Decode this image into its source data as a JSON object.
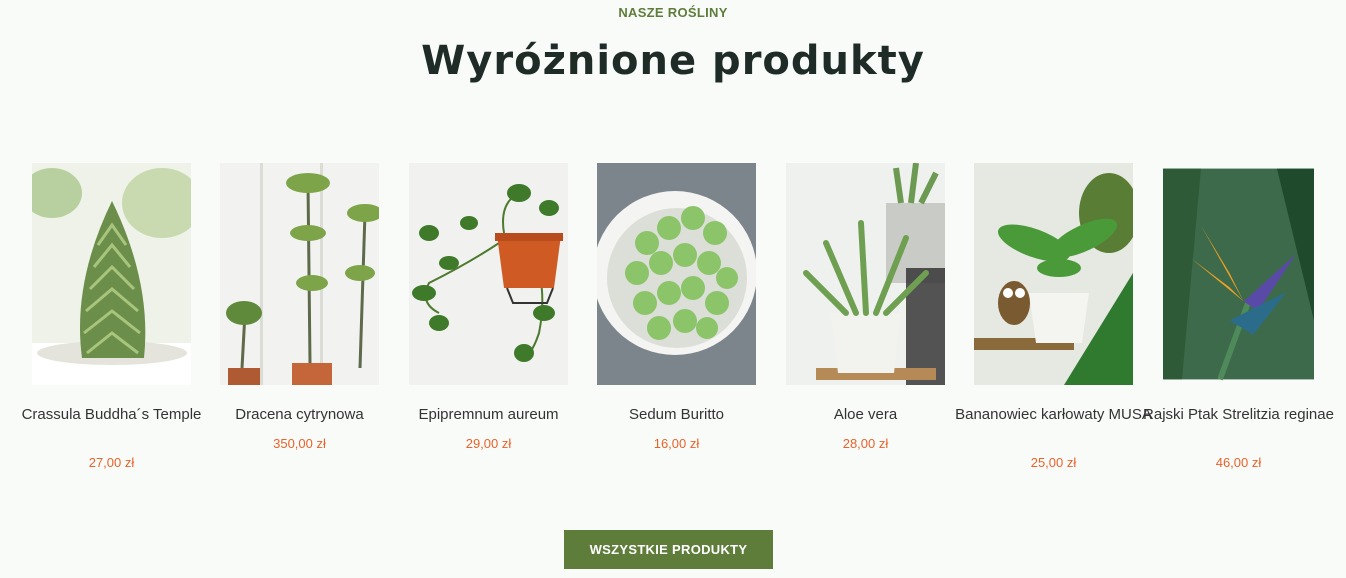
{
  "section": {
    "eyebrow": "NASZE ROŚLINY",
    "title": "Wyróżnione produkty"
  },
  "products": [
    {
      "name": "Crassula Buddha´s Temple",
      "price": "27,00 zł",
      "image_icon": "crassula-plant-image"
    },
    {
      "name": "Dracena cytrynowa",
      "price": "350,00 zł",
      "image_icon": "dracena-plant-image"
    },
    {
      "name": "Epipremnum aureum",
      "price": "29,00 zł",
      "image_icon": "epipremnum-plant-image"
    },
    {
      "name": "Sedum Buritto",
      "price": "16,00 zł",
      "image_icon": "sedum-plant-image"
    },
    {
      "name": "Aloe vera",
      "price": "28,00 zł",
      "image_icon": "aloe-plant-image"
    },
    {
      "name": "Bananowiec karłowaty MUSA",
      "price": "25,00 zł",
      "image_icon": "banana-plant-image"
    },
    {
      "name": "Rajski Ptak Strelitzia reginae",
      "price": "46,00 zł",
      "image_icon": "strelitzia-plant-image"
    }
  ],
  "cta": {
    "label": "WSZYSTKIE PRODUKTY"
  },
  "colors": {
    "accent": "#5e7d3a",
    "price": "#e8632b",
    "title": "#1e2b26"
  }
}
